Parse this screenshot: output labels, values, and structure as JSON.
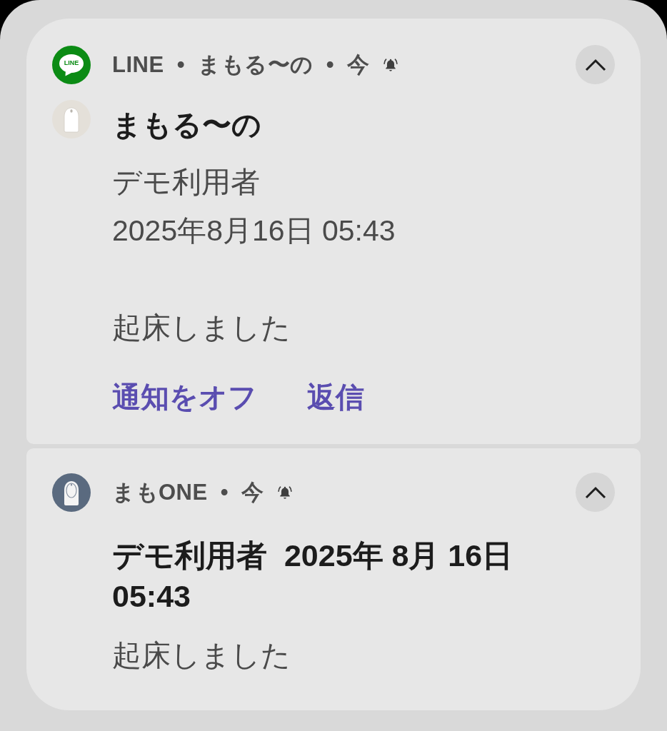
{
  "notifications": [
    {
      "icon": {
        "kind": "chat_logo",
        "text": "LINE"
      },
      "header": "LINE • まもる〜の • 今",
      "alerting": true,
      "expanded": true,
      "avatar": {
        "kind": "device"
      },
      "title": "まもる〜の",
      "message": "デモ利用者\n2025年8月16日 05:43\n\n起床しました",
      "actions": [
        "通知をオフ",
        "返信"
      ]
    },
    {
      "icon": {
        "kind": "device"
      },
      "header": "まもONE • 今",
      "alerting": true,
      "expanded": true,
      "title": "デモ利用者  2025年 8月 16日 05:43",
      "message": "起床しました"
    }
  ]
}
